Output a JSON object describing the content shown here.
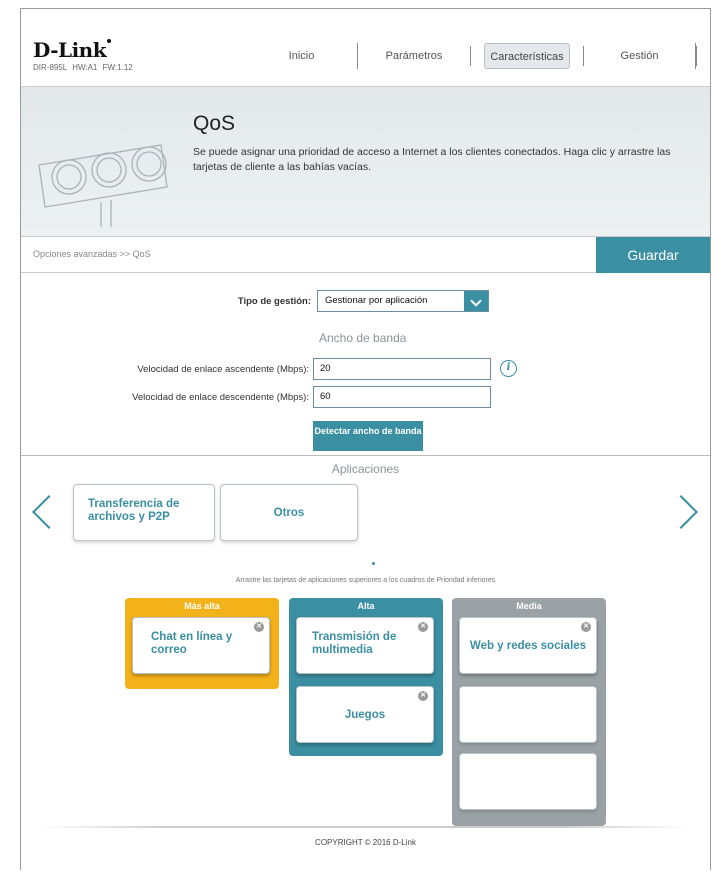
{
  "header": {
    "brand": "D-Link",
    "model": "DIR-895L",
    "hw": "HW:A1",
    "fw": "FW:1.12",
    "nav": [
      {
        "label": "Inicio",
        "active": false
      },
      {
        "label": "Parámetros",
        "active": false
      },
      {
        "label": "Características",
        "active": true
      },
      {
        "label": "Gestión",
        "active": false
      }
    ]
  },
  "banner": {
    "title": "QoS",
    "description": "Se puede asignar una prioridad de acceso a Internet a los clientes conectados. Haga clic y arrastre las tarjetas de cliente a las bahías vacías."
  },
  "breadcrumb": "Opciones avanzadas >> QoS",
  "save_label": "Guardar",
  "settings": {
    "mgmt_type_label": "Tipo de gestión:",
    "mgmt_type_value": "Gestionar por aplicación",
    "bandwidth_heading": "Ancho de banda",
    "upload_label": "Velocidad de enlace ascendente (Mbps):",
    "upload_value": "20",
    "download_label": "Velocidad de enlace descendente (Mbps):",
    "download_value": "60",
    "detect_button": "Detectar ancho de banda"
  },
  "apps": {
    "title": "Aplicaciones",
    "pool": [
      "Transferencia de archivos y P2P",
      "Otros"
    ],
    "hint": "Arrastre las tarjetas de aplicaciones superiores a los cuadros de Prioridad inferiores",
    "bays": {
      "highest": {
        "label": "Más alta",
        "cards": [
          "Chat en línea y correo"
        ]
      },
      "high": {
        "label": "Alta",
        "cards": [
          "Transmisión de multimedia",
          "Juegos"
        ]
      },
      "medium": {
        "label": "Media",
        "cards": [
          "Web y redes sociales"
        ]
      }
    }
  },
  "copyright": "COPYRIGHT © 2016 D-Link",
  "colors": {
    "accent": "#3a8fa3",
    "highest": "#f4b21a",
    "high": "#3a8fa3",
    "medium": "#9aa2a6"
  }
}
